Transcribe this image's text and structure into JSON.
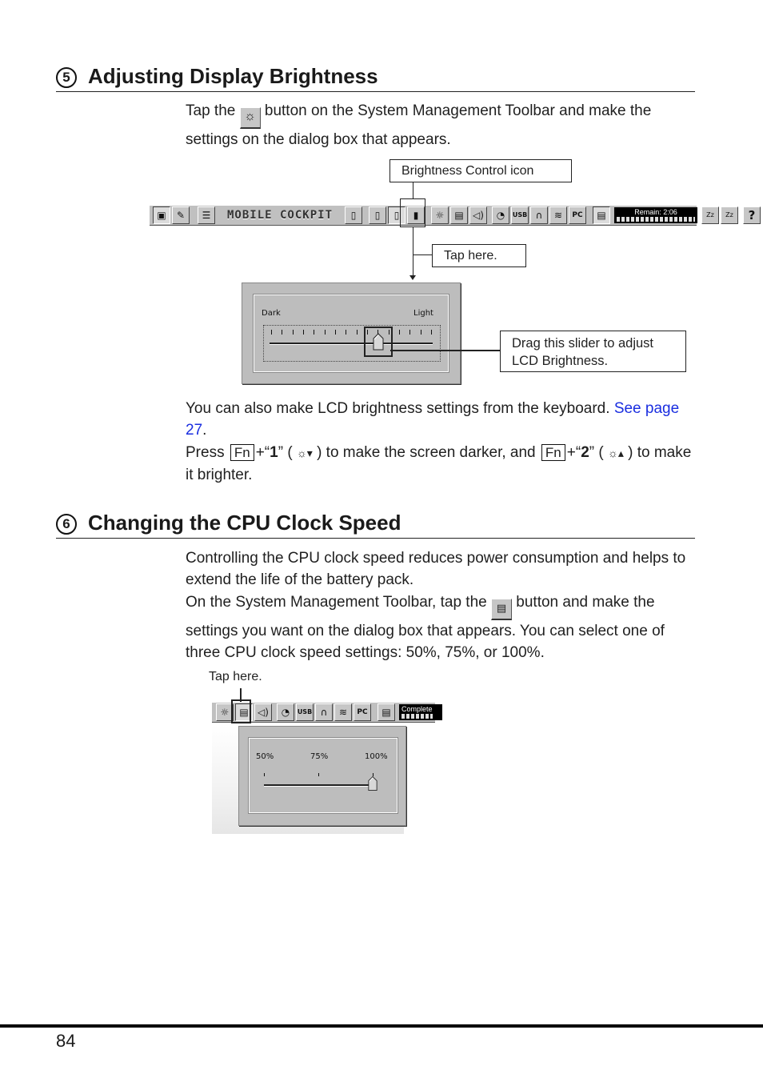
{
  "section5": {
    "number": "5",
    "title": "Adjusting Display Brightness",
    "intro_part1": "Tap the",
    "intro_icon": "brightness-icon",
    "intro_part2": "button on the System Management Toolbar and make the settings on the dialog box that appears.",
    "callouts": {
      "brightness_icon": "Brightness Control icon",
      "tap_here": "Tap here.",
      "drag_slider": "Drag this slider to adjust LCD Brightness."
    },
    "toolbar": {
      "brand": "MOBILE COCKPIT",
      "remain_label": "Remain:  2:06",
      "buttons": [
        "briefcase-icon",
        "pen-icon",
        "settings-icon",
        "battery-icon",
        "battery-icon",
        "battery-icon",
        "battery-icon",
        "brightness-icon",
        "cpu-speed-icon",
        "speaker-icon",
        "disk-icon",
        "usb-icon",
        "modem-icon",
        "wireless-icon",
        "pc-card-icon",
        "clipboard-icon",
        "suspend-icon",
        "hibernate-icon",
        "help-icon"
      ],
      "usb_label": "USB",
      "pc_label": "PC",
      "help_label": "?",
      "suspend_label": "Zz",
      "hibernate_label": "Zz"
    },
    "dialog": {
      "min_label": "Dark",
      "max_label": "Light",
      "tick_count": 16,
      "value_fraction": 0.67
    },
    "keyboard_text1": "You can also make LCD brightness settings from the keyboard.",
    "see_link": "See page 27",
    "keyboard_text1_end": ".",
    "press": "Press",
    "fn_key": "Fn",
    "plus_open_quote": "+“",
    "key1": "1",
    "close_quote_paren": "” (",
    "sun_down": "☼▾",
    "darker_text": ") to make the screen darker, and",
    "key2": "2",
    "sun_up": "☼▴",
    "brighter_text": ") to make it brighter."
  },
  "section6": {
    "number": "6",
    "title": "Changing the CPU Clock Speed",
    "para1": "Controlling the CPU clock speed reduces power consumption and helps to extend the life of the battery pack.",
    "para2_part1": "On the System Management Toolbar, tap the",
    "para2_icon": "cpu-speed-icon",
    "para2_part2": "button and make the settings you want on the dialog box that appears. You can select one of three CPU clock speed settings: 50%, 75%, or 100%.",
    "tap_here": "Tap here.",
    "toolbar_status": "Complete",
    "dialog": {
      "options": [
        "50%",
        "75%",
        "100%"
      ],
      "selected": "100%"
    }
  },
  "footer": {
    "page_number": "84"
  }
}
